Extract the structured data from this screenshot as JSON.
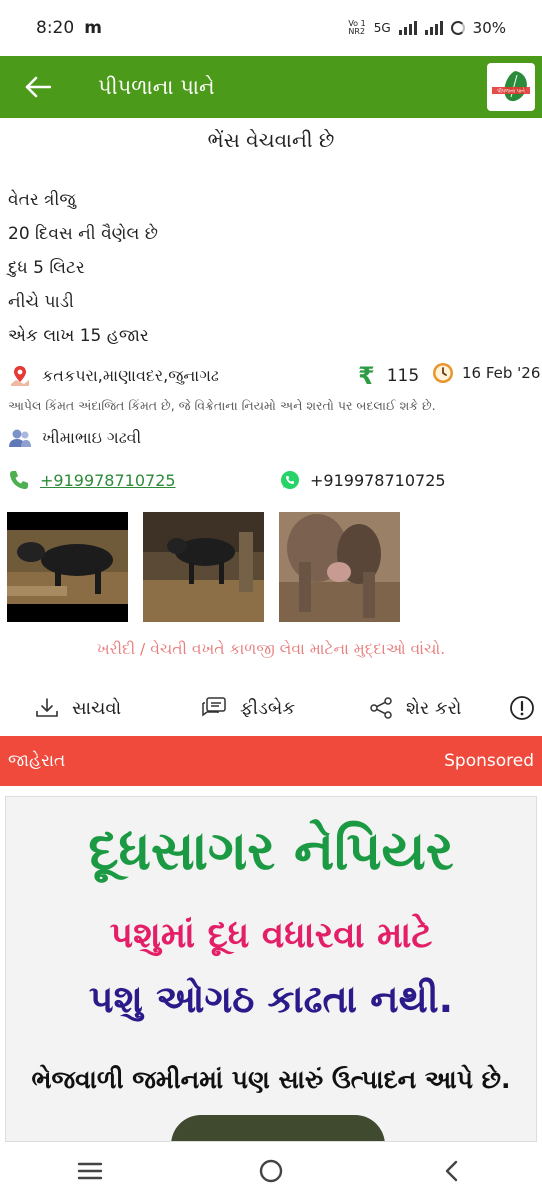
{
  "status_bar": {
    "time": "8:20",
    "app_indicator": "m",
    "network_label_top": "Vo 1",
    "network_label_bottom": "NR2",
    "network_type": "5G",
    "battery": "30%"
  },
  "app_bar": {
    "title": "પીપળાના પાને",
    "logo_text": "પીપળાના પાને"
  },
  "post": {
    "title": "ભેંસ વેચવાની છે",
    "description_lines": [
      "વેતર ત્રીજુ",
      "20 દિવસ ની વૈણેલ છે",
      "દુધ 5 લિટર",
      "નીચે પાડી",
      "એક લાખ 15 હજાર"
    ],
    "location": "કતકપરા,માણાવદર,જુનાગઢ",
    "price": "115",
    "date": "16 Feb '26",
    "disclaimer": "આપેલ કિંમત અંદાજિત કિંમત છે, જે વિક્રેતાના નિયમો અને શરતો પર બદલાઈ શકે છે.",
    "seller": "ખીમાભાઇ ગઢવી",
    "phone": "+919978710725",
    "whatsapp": "+919978710725",
    "tips_link": "ખરીદી / વેચતી વખતે કાળજી લેવા માટેના મુદ્દાઓ વાંચો."
  },
  "actions": {
    "save": "સાચવો",
    "feedback": "ફીડબેક",
    "share": "શેર કરો"
  },
  "ad": {
    "label": "જાહેરાત",
    "sponsored": "Sponsored",
    "line1": "દૂધસાગર નેપિયર",
    "line2": "પશુમાં દૂધ વધારવા માટે",
    "line3": "પશુ ઓગઠ કાઢતા નથી.",
    "line4": "ભેજવાળી જમીનમાં પણ સારું ઉત્પાદન આપે છે."
  },
  "colors": {
    "app_bar": "#4c9a1a",
    "ad_bar": "#ef4a3c",
    "link_green": "#2e8b3a",
    "tips": "#e87f7f"
  }
}
